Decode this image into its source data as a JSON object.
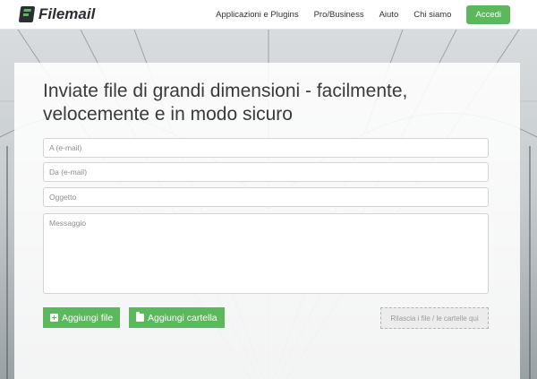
{
  "navbar": {
    "brand": "Filemail",
    "links": [
      "Applicazioni e Plugins",
      "Pro/Business",
      "Aiuto",
      "Chi siamo"
    ],
    "login_label": "Accedi"
  },
  "form": {
    "heading": "Inviate file di grandi dimensioni - facilmente, velocemente e in modo sicuro",
    "to_placeholder": "A (e-mail)",
    "from_placeholder": "Da (e-mail)",
    "subject_placeholder": "Oggetto",
    "message_placeholder": "Messaggio",
    "add_files_label": "Aggiungi file",
    "add_folder_label": "Aggiungi cartella",
    "drop_label": "Rilascia i file / le cartelle qui"
  },
  "colors": {
    "accent": "#5cb85c",
    "logo_dark": "#2b2f33"
  },
  "icons": {
    "add_files": "plus-square-icon",
    "add_folder": "folder-icon"
  }
}
